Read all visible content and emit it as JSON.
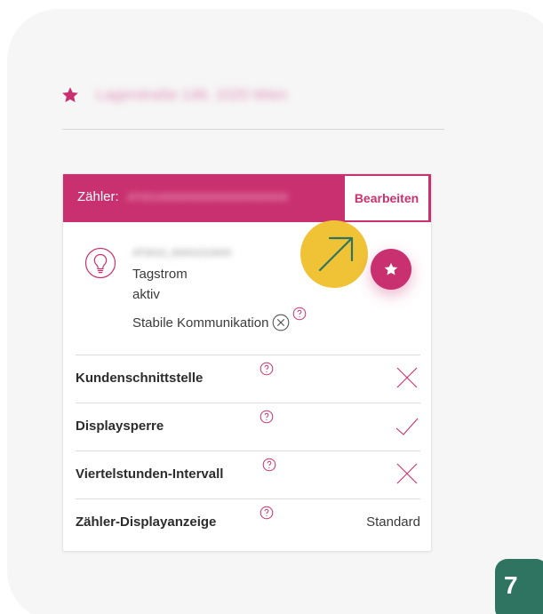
{
  "address": {
    "text": "Lagerstraße 148, 1020 Wien"
  },
  "meter_card": {
    "header_label": "Zähler:",
    "meter_id": "AT0010000000000000000000000",
    "edit_label": "Bearbeiten",
    "device_id": "AT0010_00001010000",
    "tariff": "Tagstrom",
    "status": "aktiv",
    "communication_label": "Stabile Kommunikation",
    "rows": [
      {
        "label": "Kundenschnittstelle",
        "value_icon": "cross-icon"
      },
      {
        "label": "Displaysperre",
        "value_icon": "check-icon"
      },
      {
        "label": "Viertelstunden-Intervall",
        "value_icon": "cross-icon"
      },
      {
        "label": "Zähler-Displayanzeige",
        "value_text": "Standard"
      }
    ]
  },
  "step_badge": {
    "number": "7"
  },
  "colors": {
    "brand": "#c9306f",
    "highlight": "#f0c336",
    "badge": "#2f7460",
    "arrow": "#2f7460"
  },
  "icons": {
    "favorite": "star-icon",
    "device": "lightbulb-icon",
    "help": "question-circle-icon",
    "pointer": "arrow-up-right-icon"
  }
}
